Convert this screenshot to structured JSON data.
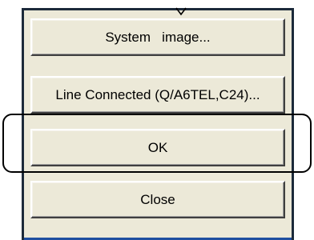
{
  "dialog": {
    "buttons": [
      {
        "label": "System   image..."
      },
      {
        "label": "Line Connected (Q/A6TEL,C24)..."
      },
      {
        "label": "OK"
      },
      {
        "label": "Close"
      }
    ]
  },
  "colors": {
    "dialog_bg": "#ece9d8",
    "frame": "#1c2a3a",
    "bottom_accent": "#1f4fa0",
    "highlight_ring": "#000000"
  },
  "icons": {
    "top_marker": "chevron-down-icon"
  }
}
